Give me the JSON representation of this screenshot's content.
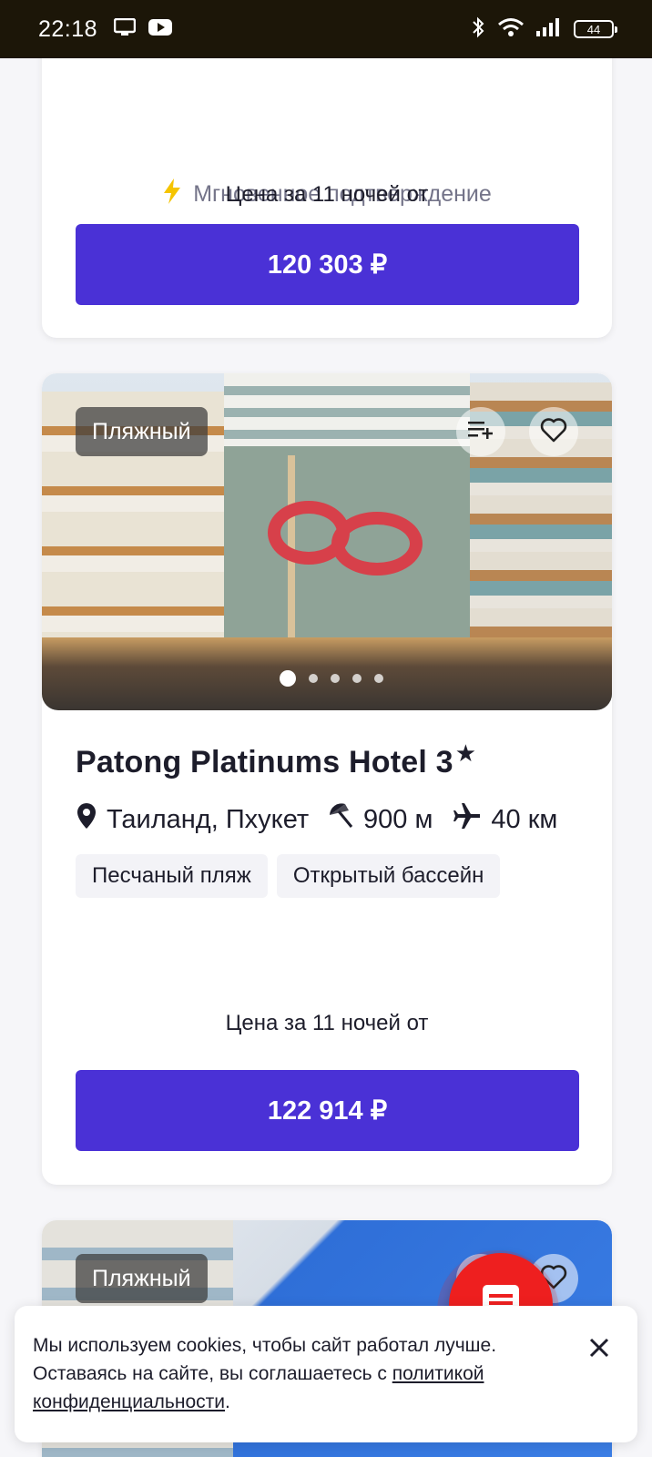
{
  "status_bar": {
    "time": "22:18",
    "battery": "44",
    "icons": [
      "tv-icon",
      "youtube-icon",
      "bluetooth-icon",
      "wifi-icon",
      "signal-icon",
      "battery-icon"
    ]
  },
  "top_card": {
    "instant_confirm": "Мгновенное подтверждение",
    "price_caption": "Цена за 11 ночей от",
    "price_button": "120 303 ₽"
  },
  "hotel_card": {
    "tag": "Пляжный",
    "name": "Patong Platinums Hotel 3",
    "stars_symbol": "★",
    "location": "Таиланд, Пхукет",
    "beach_distance": "900 м",
    "airport_distance": "40 км",
    "chips": [
      "Песчаный пляж",
      "Открытый бассейн"
    ],
    "price_caption": "Цена за 11 ночей от",
    "price_button": "122 914 ₽",
    "photo_count": 5,
    "active_photo": 1
  },
  "next_card": {
    "tag": "Пляжный"
  },
  "cookie_banner": {
    "text_before": "Мы используем cookies, чтобы сайт работал лучше. Оставаясь на сайте, вы соглашаетесь с ",
    "link_text": "политикой конфиденциальности",
    "text_after": "."
  },
  "colors": {
    "primary": "#4a31d6",
    "fab": "#ee1f1f",
    "instant_icon": "#f5c400"
  }
}
